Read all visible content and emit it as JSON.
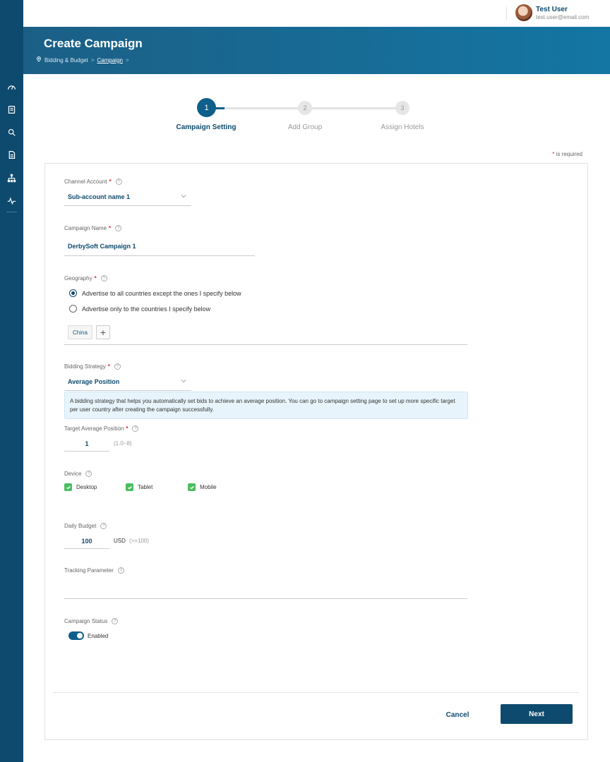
{
  "user": {
    "name": "Test User",
    "email": "test.user@email.com"
  },
  "header": {
    "title": "Create Campaign",
    "breadcrumb": [
      "Bidding & Budget",
      "Campaign"
    ]
  },
  "steps": [
    {
      "number": "1",
      "label": "Campaign Setting",
      "active": true
    },
    {
      "number": "2",
      "label": "Add Group",
      "active": false
    },
    {
      "number": "3",
      "label": "Assign Hotels",
      "active": false
    }
  ],
  "required_note": {
    "star": "*",
    "text": "is required"
  },
  "form": {
    "channel_account": {
      "label": "Channel Account",
      "value": "Sub-account name 1"
    },
    "campaign_name": {
      "label": "Campaign Name",
      "value": "DerbySoft Campaign 1"
    },
    "geography": {
      "label": "Geography",
      "options": [
        "Advertise to all countries except the ones I specify below",
        "Advertise only to the countries I specify below"
      ],
      "selected": 0,
      "countries": [
        "China"
      ],
      "add_symbol": "+"
    },
    "bidding_strategy": {
      "label": "Bidding Strategy",
      "value": "Average Position",
      "description": "A bidding strategy that helps you automatically set bids to achieve an average position. You can go to campaign setting page to set up more specific target per user country after creating the campaign successfully."
    },
    "target_position": {
      "label": "Target Average Position",
      "value": "1",
      "hint": "(1.0~8)"
    },
    "device": {
      "label": "Device",
      "options": [
        {
          "label": "Desktop",
          "checked": true
        },
        {
          "label": "Tablet",
          "checked": true
        },
        {
          "label": "Mobile",
          "checked": true
        }
      ]
    },
    "daily_budget": {
      "label": "Daily Budget",
      "value": "100",
      "currency": "USD",
      "hint": "(>=100)"
    },
    "tracking_parameter": {
      "label": "Tracking Parameter",
      "value": ""
    },
    "campaign_status": {
      "label": "Campaign Status",
      "value": "Enabled",
      "enabled": true
    }
  },
  "actions": {
    "cancel": "Cancel",
    "next": "Next"
  },
  "required_star": "*",
  "help_glyph": "?",
  "colors": {
    "primary": "#0e4a6e",
    "accent": "#0e5f8a",
    "required": "#e0242a",
    "check": "#4cbd60",
    "info_bg": "#e8f4fb"
  }
}
